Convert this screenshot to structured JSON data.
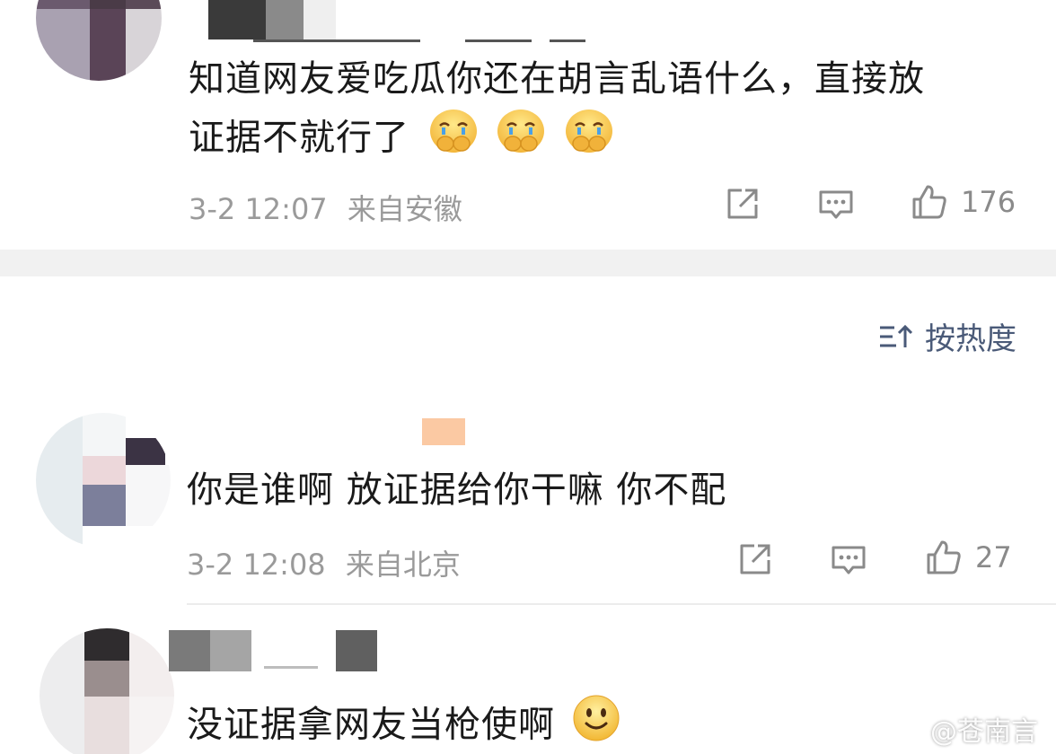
{
  "comments": [
    {
      "text_lines": [
        "知道网友爱吃瓜你还在胡言乱语什么，直接放",
        "证据不就行了"
      ],
      "emoji": "crying-emoji",
      "time": "3-2 12:07",
      "location": "来自安徽",
      "likes": "176"
    },
    {
      "text_lines": [
        "你是谁啊 放证据给你干嘛 你不配"
      ],
      "time": "3-2 12:08",
      "location": "来自北京",
      "likes": "27"
    },
    {
      "text_lines": [
        "没证据拿网友当枪使啊"
      ],
      "emoji": "smile-emoji"
    }
  ],
  "sort": {
    "label": "按热度"
  },
  "watermark": {
    "text": "@苍南言"
  },
  "colors": {
    "accent": "#4a5a78",
    "meta": "#9a9a9a",
    "separator": "#f1f1f1"
  }
}
